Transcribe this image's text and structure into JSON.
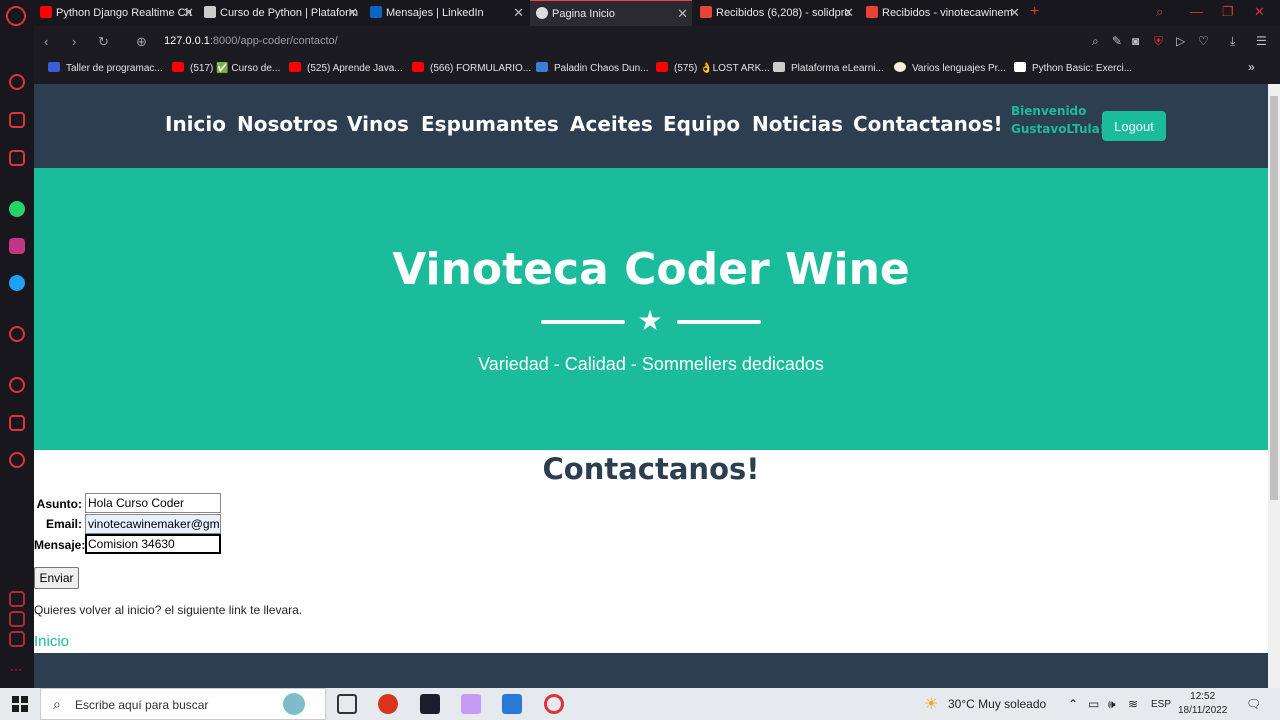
{
  "browser": {
    "tabs": [
      {
        "title": "Python Django Realtime Ch",
        "fav_color": "#ff0000"
      },
      {
        "title": "Curso de Python | Plataform",
        "fav_color": "#cccccc"
      },
      {
        "title": "Mensajes | LinkedIn",
        "fav_color": "#0a66c2"
      },
      {
        "title": "Pagina Inicio",
        "fav_color": "#dddddd"
      },
      {
        "title": "Recibidos (6,208) - solidpro",
        "fav_color": "#ea4335"
      },
      {
        "title": "Recibidos - vinotecawinem",
        "fav_color": "#ea4335"
      }
    ],
    "url_host": "127.0.0.1",
    "url_path": ":8000/app-coder/contacto/",
    "bookmarks": [
      {
        "label": "Taller de programac...",
        "fav_color": "#3b5bdb"
      },
      {
        "label": "(517) ✅ Curso de...",
        "fav_color": "#ff0000"
      },
      {
        "label": "(525) Aprende Java...",
        "fav_color": "#ff0000"
      },
      {
        "label": "(566) FORMULARIO...",
        "fav_color": "#ff0000"
      },
      {
        "label": "Paladin Chaos Dun...",
        "fav_color": "#3b7dd8"
      },
      {
        "label": "(575) 👌LOST ARK...",
        "fav_color": "#ff0000"
      },
      {
        "label": "Plataforma eLearni...",
        "fav_color": "#cccccc"
      },
      {
        "label": "Varios lenguajes Pr...",
        "fav_color": "#f5f0dc"
      },
      {
        "label": "Python Basic: Exerci...",
        "fav_color": "#ffffff"
      }
    ]
  },
  "site": {
    "nav": [
      "Inicio",
      "Nosotros",
      "Vinos",
      "Espumantes",
      "Aceites",
      "Equipo",
      "Noticias",
      "Contactanos!"
    ],
    "welcome_line1": "Bienvenido",
    "welcome_line2": "GustavoLTula!.",
    "logout_label": "Logout",
    "hero_title": "Vinoteca Coder Wine",
    "hero_subtitle": "Variedad - Calidad - Sommeliers dedicados",
    "page_title": "Contactanos!",
    "form": {
      "asunto_label": "Asunto:",
      "asunto_value": "Hola Curso Coder",
      "email_label": "Email:",
      "email_value": "vinotecawinemaker@gm",
      "mensaje_label": "Mensaje:",
      "mensaje_value": "Comision  34630",
      "submit_label": "Enviar"
    },
    "hint_text": "Quieres volver al inicio? el siguiente link te llevara.",
    "home_link": "Inicio"
  },
  "taskbar": {
    "search_placeholder": "Escribe aquí para buscar",
    "weather": "30°C  Muy soleado",
    "lang": "ESP",
    "time": "12:52",
    "date": "18/11/2022"
  },
  "colors": {
    "accent": "#1abc9c",
    "navbar": "#2c3e50",
    "opera_red": "#e0323b"
  }
}
